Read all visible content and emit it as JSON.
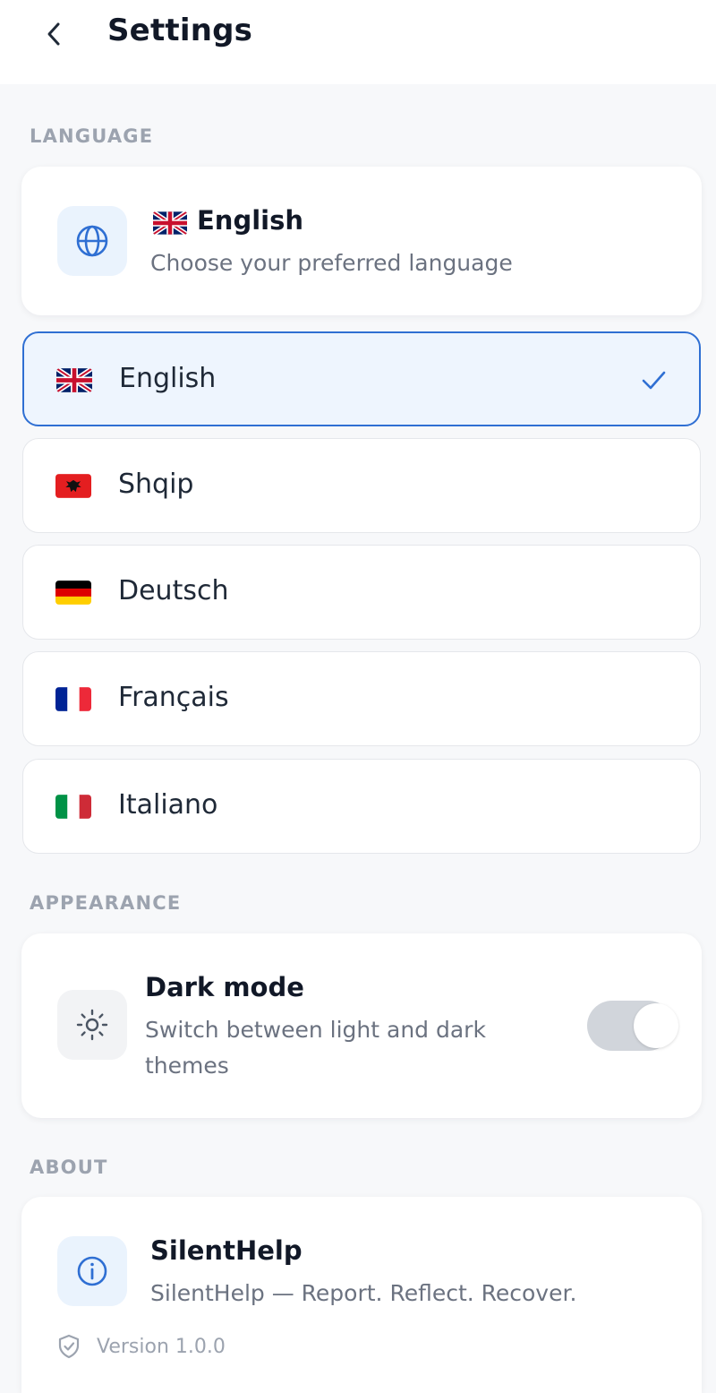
{
  "header": {
    "title": "Settings",
    "back_icon": "chevron-left-icon"
  },
  "language_section": {
    "label": "LANGUAGE",
    "summary": {
      "icon": "globe-icon",
      "current": "English",
      "description": "Choose your preferred language"
    },
    "options": [
      {
        "label": "English",
        "flag": "gb",
        "selected": true
      },
      {
        "label": "Shqip",
        "flag": "al",
        "selected": false
      },
      {
        "label": "Deutsch",
        "flag": "de",
        "selected": false
      },
      {
        "label": "Français",
        "flag": "fr",
        "selected": false
      },
      {
        "label": "Italiano",
        "flag": "it",
        "selected": false
      }
    ]
  },
  "appearance_section": {
    "label": "APPEARANCE",
    "dark_mode": {
      "icon": "sun-icon",
      "title": "Dark mode",
      "description": "Switch between light and dark themes",
      "enabled": false
    }
  },
  "about_section": {
    "label": "ABOUT",
    "app": {
      "icon": "info-icon",
      "name": "SilentHelp",
      "tagline": "SilentHelp — Report. Reflect. Recover.",
      "version": "Version 1.0.0"
    }
  },
  "colors": {
    "accent": "#2f6fd3",
    "background": "#f7f8fa",
    "selected_bg": "#eef5fe"
  }
}
